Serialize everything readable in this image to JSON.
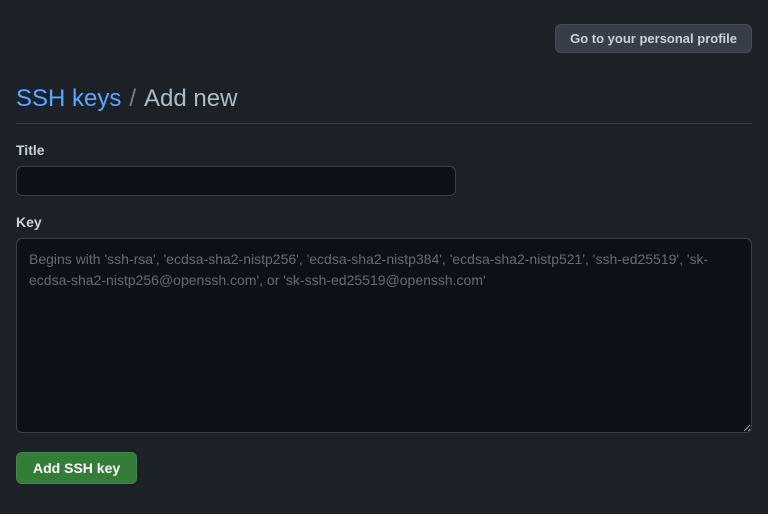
{
  "topbar": {
    "profile_button_label": "Go to your personal profile"
  },
  "breadcrumb": {
    "link_label": "SSH keys",
    "separator": "/",
    "current": "Add new"
  },
  "form": {
    "title_label": "Title",
    "title_value": "",
    "key_label": "Key",
    "key_value": "",
    "key_placeholder": "Begins with 'ssh-rsa', 'ecdsa-sha2-nistp256', 'ecdsa-sha2-nistp384', 'ecdsa-sha2-nistp521', 'ssh-ed25519', 'sk-ecdsa-sha2-nistp256@openssh.com', or 'sk-ssh-ed25519@openssh.com'",
    "submit_label": "Add SSH key"
  }
}
